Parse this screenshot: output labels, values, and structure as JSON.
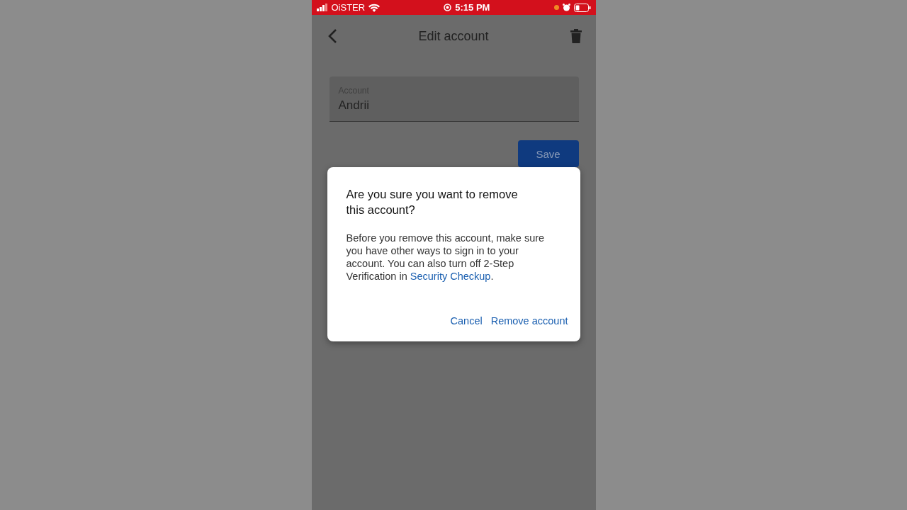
{
  "status_bar": {
    "carrier": "OiSTER",
    "time": "5:15 PM"
  },
  "header": {
    "title": "Edit account"
  },
  "account_field": {
    "label": "Account",
    "value": "Andrii"
  },
  "save_button": "Save",
  "dialog": {
    "title": "Are you sure you want to remove this account?",
    "body_before": "Before you remove this account, make sure you have other ways to sign in to your account. You can also turn off 2-Step Verification in ",
    "link": "Security Checkup",
    "body_after": ".",
    "buttons": [
      "Cancel",
      "Remove account"
    ]
  }
}
